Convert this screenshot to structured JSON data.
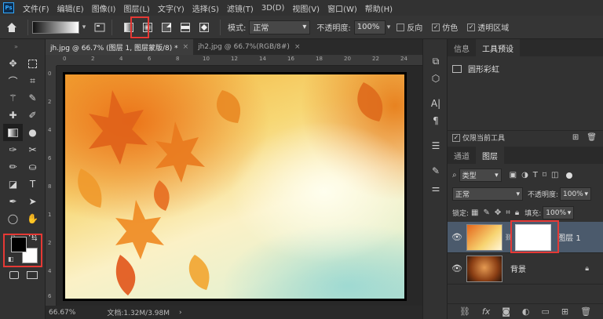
{
  "menu": {
    "logo": "Ps",
    "items": [
      "文件(F)",
      "编辑(E)",
      "图像(I)",
      "图层(L)",
      "文字(Y)",
      "选择(S)",
      "滤镜(T)",
      "3D(D)",
      "视图(V)",
      "窗口(W)",
      "帮助(H)"
    ]
  },
  "options": {
    "mode_label": "模式:",
    "mode_value": "正常",
    "opacity_label": "不透明度:",
    "opacity_value": "100%",
    "reverse_label": "反向",
    "dither_label": "仿色",
    "transparency_label": "透明区域"
  },
  "tabs": [
    {
      "label": "jh.jpg @ 66.7% (图层 1, 图层蒙版/8) *",
      "close": "×"
    },
    {
      "label": "jh2.jpg @ 66.7%(RGB/8#)",
      "close": "×"
    }
  ],
  "ruler": {
    "top": [
      "0",
      "2",
      "4",
      "6",
      "8",
      "10",
      "12",
      "14",
      "16",
      "18",
      "20",
      "22",
      "24"
    ],
    "left": [
      "0",
      "2",
      "4",
      "6",
      "8",
      "1",
      "2",
      "4",
      "6"
    ]
  },
  "status": {
    "zoom": "66.67%",
    "doc_info": "文档:1.32M/3.98M",
    "arrow": "›"
  },
  "panel_top": {
    "tabs": [
      "信息",
      "工具预设"
    ],
    "preset_item": "圆形彩虹",
    "current_only": "仅限当前工具"
  },
  "layers_panel": {
    "tabs": [
      "通道",
      "图层"
    ],
    "filter_kind": "类型",
    "blend_mode": "正常",
    "opacity_label": "不透明度:",
    "opacity_value": "100%",
    "lock_label": "锁定:",
    "fill_label": "填充:",
    "fill_value": "100%",
    "layers": [
      {
        "name": "图层 1"
      },
      {
        "name": "背景"
      }
    ]
  },
  "colors": {
    "accent_red": "#e53935",
    "foreground": "#000000",
    "background": "#ffffff"
  }
}
